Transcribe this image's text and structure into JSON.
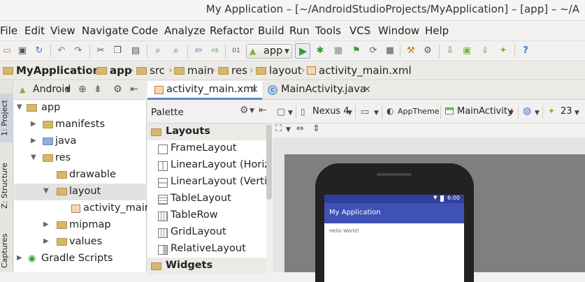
{
  "window": {
    "title": "My Application – [~/AndroidStudioProjects/MyApplication] – [app] – ~/A"
  },
  "menu": [
    "File",
    "Edit",
    "View",
    "Navigate",
    "Code",
    "Analyze",
    "Refactor",
    "Build",
    "Run",
    "Tools",
    "VCS",
    "Window",
    "Help"
  ],
  "toolbar": {
    "run_config": "app"
  },
  "breadcrumb": [
    "MyApplication",
    "app",
    "src",
    "main",
    "res",
    "layout",
    "activity_main.xml"
  ],
  "side_tabs": {
    "project": "1: Project",
    "structure": "Z: Structure",
    "captures": "Captures"
  },
  "project_panel": {
    "view_mode": "Android",
    "tree": [
      {
        "label": "app",
        "bold": false
      },
      {
        "label": "manifests"
      },
      {
        "label": "java"
      },
      {
        "label": "res"
      },
      {
        "label": "drawable"
      },
      {
        "label": "layout"
      },
      {
        "label": "activity_main."
      },
      {
        "label": "mipmap"
      },
      {
        "label": "values"
      },
      {
        "label": "Gradle Scripts"
      }
    ]
  },
  "editor_tabs": [
    {
      "label": "activity_main.xml",
      "close": "×"
    },
    {
      "label": "MainActivity.java",
      "close": "×"
    }
  ],
  "palette": {
    "title": "Palette",
    "group_layouts": "Layouts",
    "items": [
      "FrameLayout",
      "LinearLayout (Horiz",
      "LinearLayout (Vertic",
      "TableLayout",
      "TableRow",
      "GridLayout",
      "RelativeLayout"
    ],
    "group_widgets": "Widgets"
  },
  "design_toolbar": {
    "device": "Nexus 4",
    "theme": "AppTheme",
    "activity": "MainActivity",
    "api": "23"
  },
  "preview": {
    "time": "6:00",
    "app_title": "My Application",
    "content": "Hello World!",
    "colors": {
      "status": "#303f9f",
      "appbar": "#3f51b5"
    }
  }
}
